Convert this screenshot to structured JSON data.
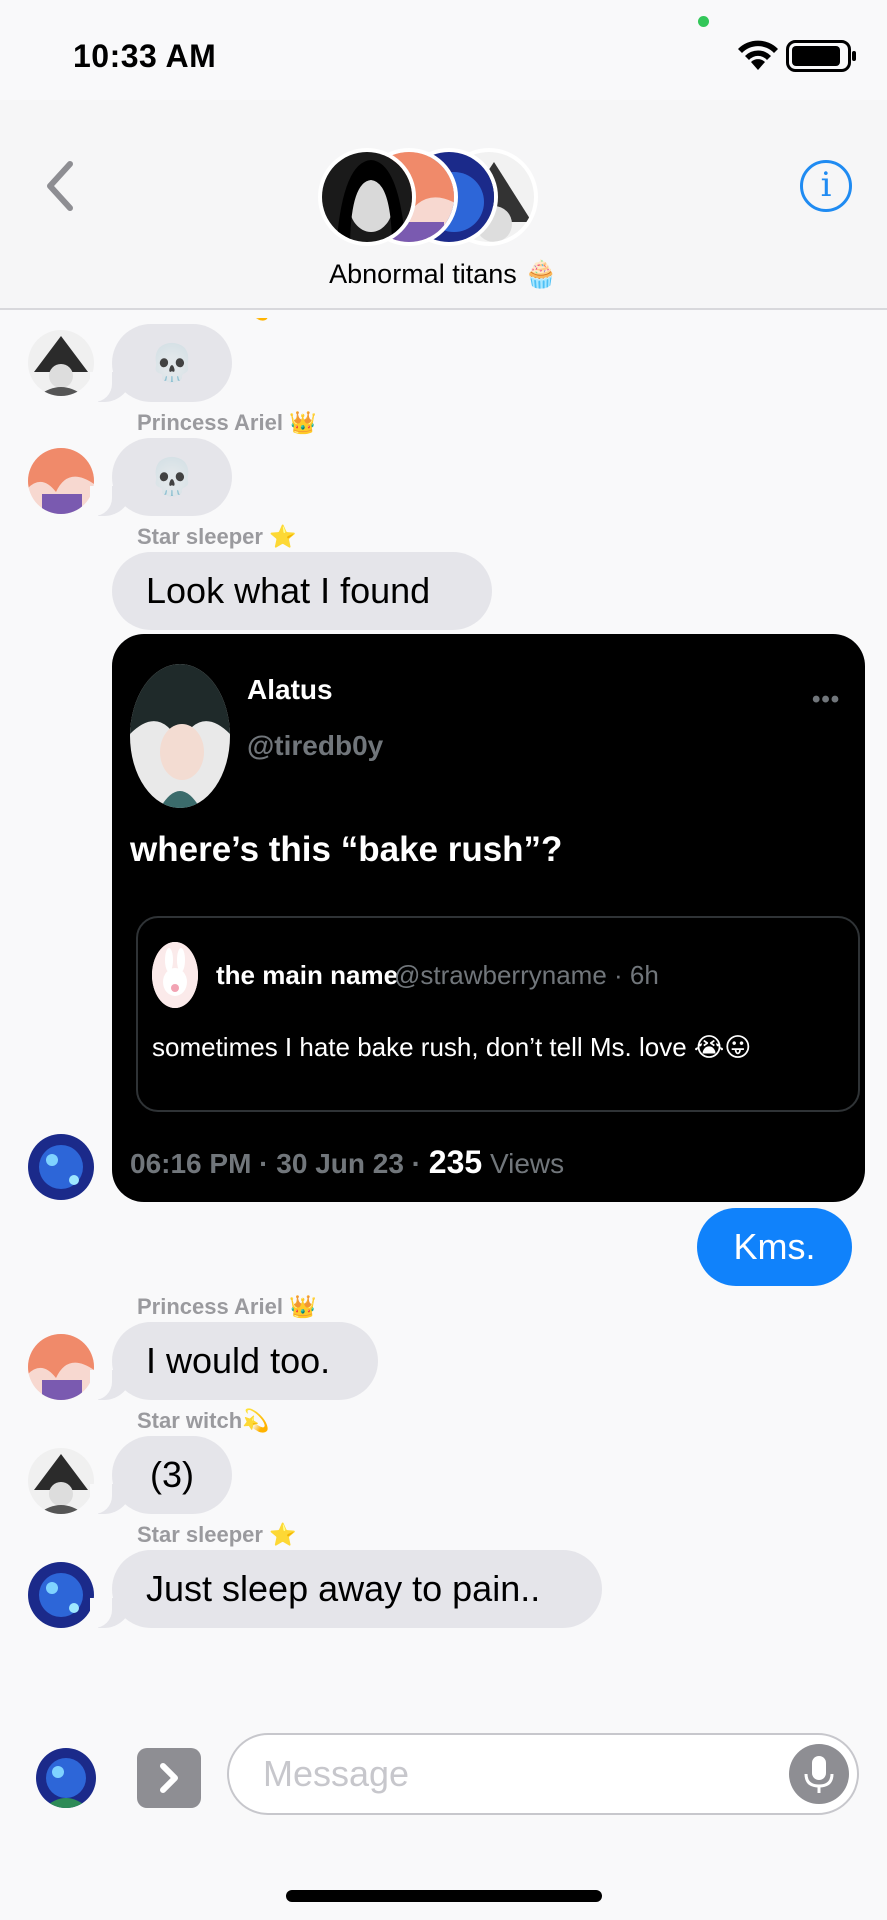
{
  "status_bar": {
    "time": "10:33 AM"
  },
  "header": {
    "group_name": "Abnormal titans 🧁",
    "info_label": "i"
  },
  "messages": [
    {
      "sender": "Star witch💫",
      "text": "💀"
    },
    {
      "sender": "Princess Ariel 👑",
      "text": "💀"
    },
    {
      "sender": "Star sleeper ⭐️",
      "text": "Look what I found"
    },
    {
      "outgoing": true,
      "text": "Kms."
    },
    {
      "sender": "Princess Ariel 👑",
      "text": "I would too."
    },
    {
      "sender": "Star witch💫",
      "text": "(3)"
    },
    {
      "sender": "Star sleeper ⭐️",
      "text": "Just sleep away to pain.."
    }
  ],
  "tweet": {
    "name": "Alatus",
    "handle": "@tiredb0y",
    "more": "•••",
    "text": "where’s this “bake rush”?",
    "quote": {
      "name": "the main name",
      "handle_time": "@strawberryname · 6h",
      "text": "sometimes I hate bake rush, don’t tell Ms. love 😭😛"
    },
    "timestamp": "06:16 PM · 30 Jun 23 · ",
    "views_count": "235",
    "views_label": " Views"
  },
  "composer": {
    "placeholder": "Message"
  },
  "colors": {
    "accent": "#1082fb",
    "incoming_bubble": "#e5e5ea",
    "tweet_bg": "#000000"
  }
}
